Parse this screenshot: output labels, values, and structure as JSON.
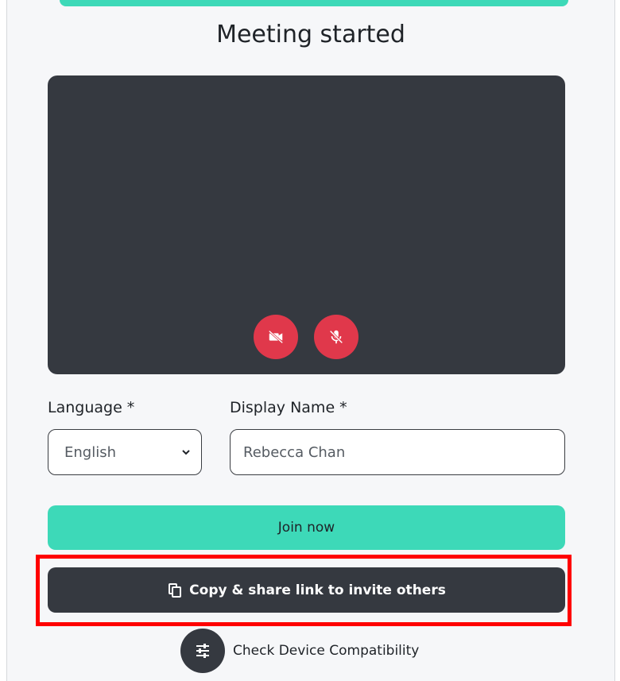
{
  "header": {
    "title": "Meeting started"
  },
  "video": {
    "camera_button_icon": "camera-off-icon",
    "mic_button_icon": "mic-off-icon"
  },
  "form": {
    "language_label": "Language *",
    "language_value": "English",
    "display_name_label": "Display Name *",
    "display_name_value": "Rebecca Chan"
  },
  "actions": {
    "join_label": "Join now",
    "copy_label": "Copy & share link to invite others",
    "check_label": "Check Device Compatibility"
  },
  "colors": {
    "accent": "#3dd9b8",
    "dark": "#353940",
    "danger": "#e0384b",
    "highlight": "#ff0000"
  }
}
